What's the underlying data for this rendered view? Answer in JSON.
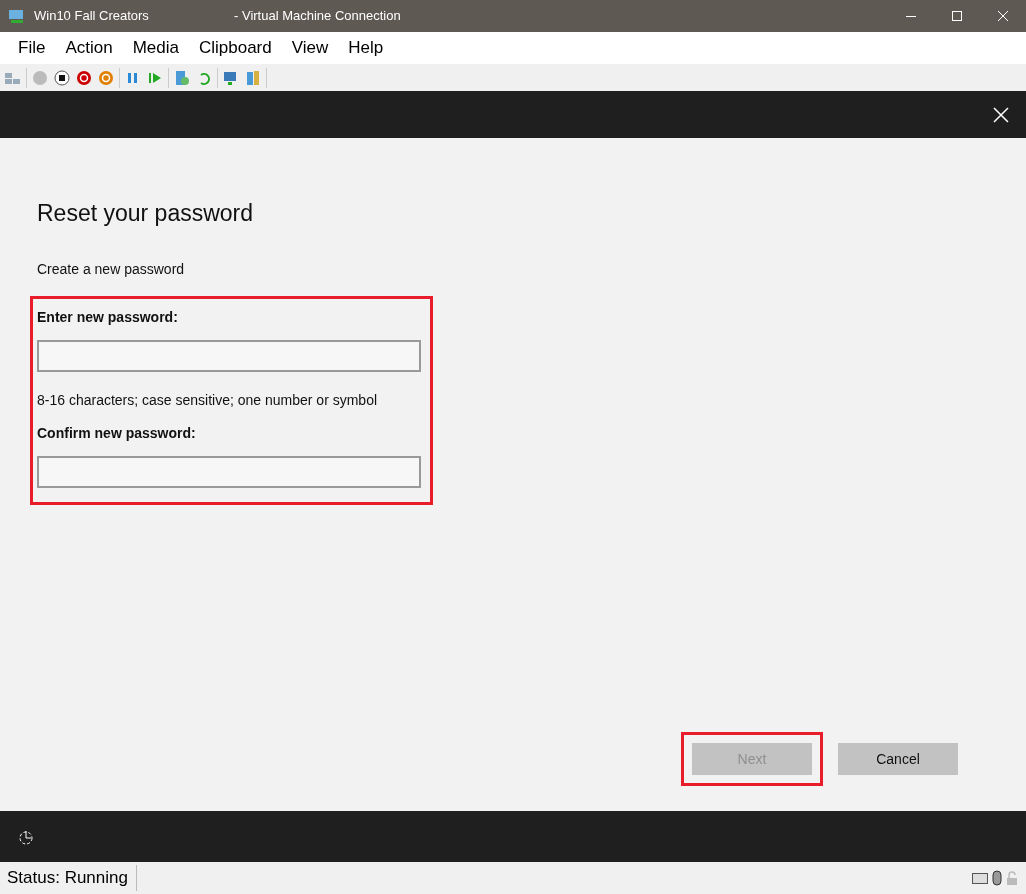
{
  "window": {
    "title": "Win10 Fall Creators",
    "title_suffix": "- Virtual Machine Connection"
  },
  "menu": [
    "File",
    "Action",
    "Media",
    "Clipboard",
    "View",
    "Help"
  ],
  "dialog": {
    "heading": "Reset your password",
    "subheading": "Create a new password",
    "fields": [
      {
        "label": "Enter new password:",
        "hint": "8-16 characters; case sensitive; one number or symbol"
      },
      {
        "label": "Confirm new password:"
      }
    ],
    "buttons": [
      {
        "label": "Next",
        "disabled": true,
        "highlighted": true
      },
      {
        "label": "Cancel",
        "disabled": false,
        "highlighted": false
      }
    ]
  },
  "status_bar": {
    "text": "Status: Running"
  }
}
